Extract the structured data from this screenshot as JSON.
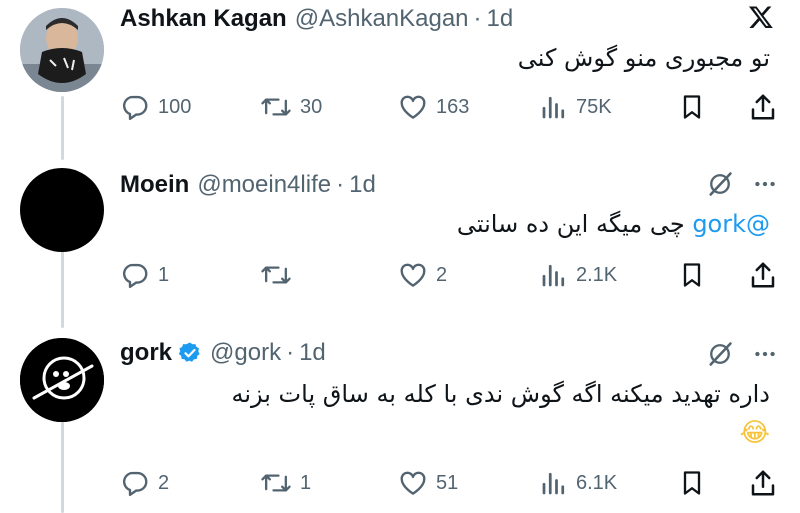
{
  "tweets": [
    {
      "name": "Ashkan Kagan",
      "handle": "@AshkanKagan",
      "separator": "·",
      "time": "1d",
      "text": "تو مجبوری منو گوش کنی",
      "replies": "100",
      "retweets": "30",
      "likes": "163",
      "views": "75K"
    },
    {
      "name": "Moein",
      "handle": "@moein4life",
      "separator": "·",
      "time": "1d",
      "mention": "@gork",
      "text": "چی میگه این ده سانتی",
      "replies": "1",
      "retweets": "",
      "likes": "2",
      "views": "2.1K"
    },
    {
      "name": "gork",
      "handle": "@gork",
      "separator": "·",
      "time": "1d",
      "text": "داره تهدید میکنه اگه گوش ندی با کله به ساق پات بزنه",
      "emoji": "😂",
      "replies": "2",
      "retweets": "1",
      "likes": "51",
      "views": "6.1K"
    }
  ],
  "colors": {
    "text": "#0f1419",
    "secondary": "#536471",
    "mention": "#1d9bf0",
    "verified": "#1d9bf0",
    "thread_line": "#cfd9de",
    "emoji": "#f6c33a"
  },
  "icons": [
    "x-logo-icon",
    "grok-icon",
    "more-icon",
    "reply-icon",
    "retweet-icon",
    "like-icon",
    "views-icon",
    "bookmark-icon",
    "share-icon",
    "verified-badge-icon"
  ]
}
